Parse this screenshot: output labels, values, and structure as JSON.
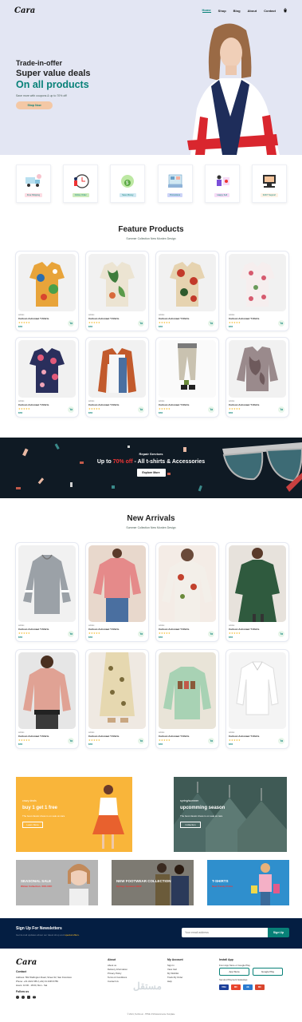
{
  "header": {
    "logo": "Cara",
    "nav": [
      "Home",
      "Shop",
      "Blog",
      "About",
      "Contact"
    ]
  },
  "hero": {
    "h4": "Trade-in-offer",
    "h2": "Super value deals",
    "h1": "On all products",
    "p": "Save more with coupons & up to 70% off!",
    "button": "Shop Now"
  },
  "features": [
    {
      "label": "Free Shipping",
      "bg": "#fddde4"
    },
    {
      "label": "Online Order",
      "bg": "#cdebbc"
    },
    {
      "label": "Save Money",
      "bg": "#d1e8f2"
    },
    {
      "label": "Promotions",
      "bg": "#cdd4f8"
    },
    {
      "label": "Happy Sell",
      "bg": "#f6dbf6"
    },
    {
      "label": "F24/7 Support",
      "bg": "#fff2e5"
    }
  ],
  "featured": {
    "title": "Feature Products",
    "subtitle": "Summer Collection New Morden Design"
  },
  "arrivals": {
    "title": "New Arrivals",
    "subtitle": "Summer Collection New Morden Design"
  },
  "product": {
    "brand": "adidas",
    "name": "Cartoon Astronaut T-Shirts",
    "stars": "★★★★★",
    "price": "$78"
  },
  "banner": {
    "h4": "Repair Services",
    "h2_pre": "Up to ",
    "h2_red": "70% off",
    "h2_post": " - All t-shirts & Accessories",
    "button": "Explore More"
  },
  "sm_banners": [
    {
      "t1": "crazy deals",
      "t2": "buy 1 get 1 free",
      "t3": "The best classic dress is on sale at cara",
      "btn": "Learn More"
    },
    {
      "t1": "spring/summer",
      "t2": "upcomming season",
      "t3": "The best classic dress is on sale at cara",
      "btn": "Collection"
    }
  ],
  "tri_banners": [
    {
      "h": "SEASONAL SALE",
      "s": "Winter Collection -50% OFF"
    },
    {
      "h": "NEW FOOTWEAR COLLECTION",
      "s": "Spring / Summer 2022"
    },
    {
      "h": "T-SHIRTS",
      "s": "New Trendy Prints"
    }
  ],
  "newsletter": {
    "title": "Sign Up For Newsletters",
    "p_pre": "Get E-mail updates about our latest shop and ",
    "p_hl": "special offers.",
    "placeholder": "Your email address",
    "button": "Sign Up"
  },
  "footer": {
    "logo": "Cara",
    "contact_h": "Contact",
    "contact": [
      "Address: 562 Wellington Road, Street 32, San Francisco",
      "Phone: +01 2222 365 /(+91) 01 2345 6789",
      "Hours: 10:00 - 18:00, Mon - Sat"
    ],
    "follow_h": "Follow us",
    "about_h": "About",
    "about": [
      "About us",
      "Delivery Information",
      "Privacy Policy",
      "Terms & Conditions",
      "Contact Us"
    ],
    "account_h": "My Account",
    "account": [
      "Sign In",
      "View Cart",
      "My Wishlist",
      "Track My Order",
      "Help"
    ],
    "install_h": "Install App",
    "install_p": "From App Store or Google Play",
    "app_store": "App Store",
    "google_play": "Google Play",
    "secured": "Secured Payment Gateways",
    "pay": [
      "VISA",
      "MC",
      "AE",
      "MC"
    ],
    "copyright": "© 2021, Tech2 etc - HTML CSS Ecommerce Template",
    "watermark": "مستقل"
  }
}
